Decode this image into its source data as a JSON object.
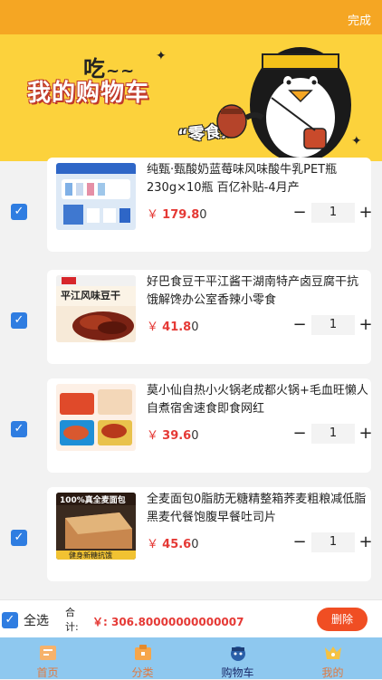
{
  "header": {
    "done_label": "完成"
  },
  "banner": {
    "eat_text": "吃",
    "eat_tilde": "~~",
    "title": "我的购物车",
    "subtitle": "“零食鹅”"
  },
  "items": [
    {
      "title": "纯甄·甄酸奶蓝莓味风味酸牛乳PET瓶230g×10瓶 百亿补贴-4月产",
      "currency": "￥",
      "price": "179.8",
      "price_tail": "0",
      "qty": "1",
      "minus": "−",
      "plus": "+"
    },
    {
      "title": "好巴食豆干平江酱干湖南特产卤豆腐干抗饿解馋办公室香辣小零食",
      "currency": "￥",
      "price": "41.8",
      "price_tail": "0",
      "qty": "1",
      "minus": "−",
      "plus": "+"
    },
    {
      "title": "莫小仙自热小火锅老成都火锅+毛血旺懒人自煮宿舍速食即食网红",
      "currency": "￥",
      "price": "39.6",
      "price_tail": "0",
      "qty": "1",
      "minus": "−",
      "plus": "+"
    },
    {
      "title": "全麦面包0脂肪无糖精整箱荞麦粗粮减低脂黑麦代餐饱腹早餐吐司片",
      "currency": "￥",
      "price": "45.6",
      "price_tail": "0",
      "qty": "1",
      "minus": "−",
      "plus": "+"
    }
  ],
  "thumbs": {
    "t2_text": "平江风味豆干",
    "t4_text": "100%真全麦面包",
    "t4_sub": "健身新糖抗饿"
  },
  "footer": {
    "select_all": "全选",
    "total_label": "合计:",
    "total_value": "￥: 306.80000000000007",
    "delete_label": "删除"
  },
  "tabs": [
    {
      "label": "首页",
      "icon": "home-icon"
    },
    {
      "label": "分类",
      "icon": "category-icon"
    },
    {
      "label": "购物车",
      "icon": "cart-icon"
    },
    {
      "label": "我的",
      "icon": "profile-icon"
    }
  ],
  "colors": {
    "accent": "#f5a623",
    "price": "#e53935",
    "checkbox": "#2f7de1",
    "tabbar": "#8ec8ef",
    "delete": "#f04e23"
  }
}
